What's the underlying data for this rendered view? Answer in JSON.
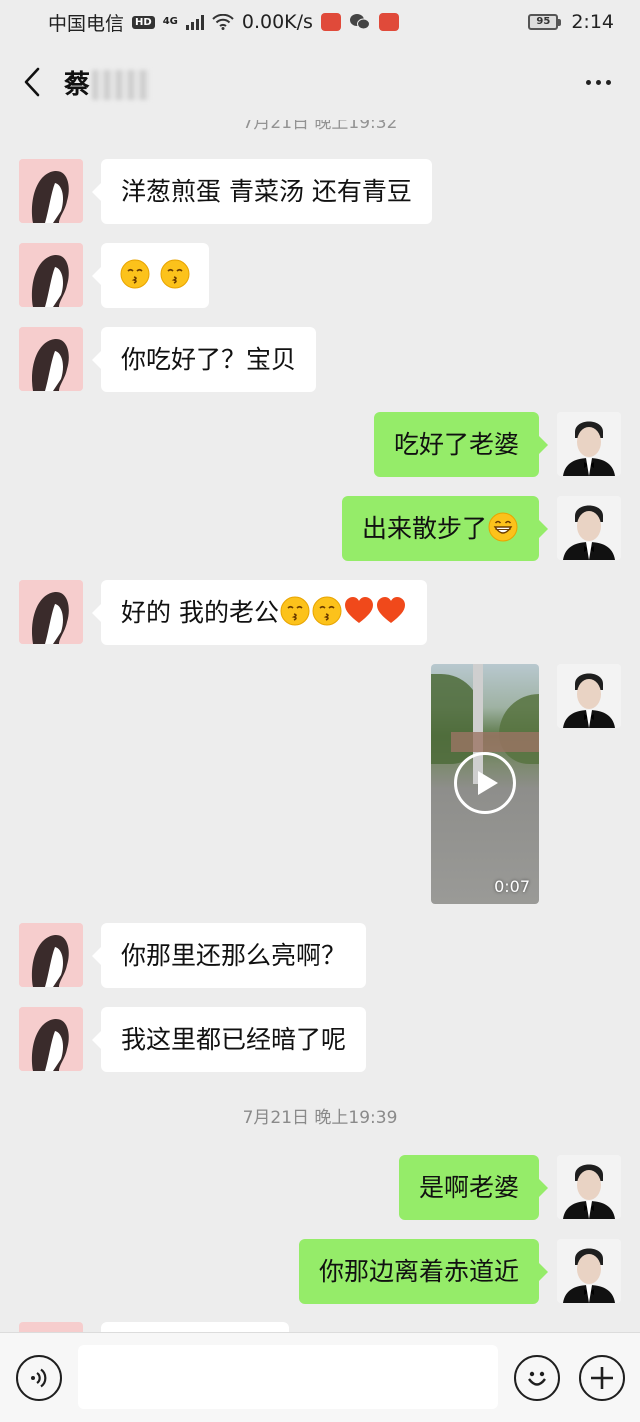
{
  "status_bar": {
    "carrier": "中国电信",
    "hd": "HD",
    "network": "4G",
    "net_speed": "0.00K/s",
    "battery": "95",
    "time": "2:14"
  },
  "header": {
    "contact_name": "蔡",
    "back_icon": "chevron-left-icon",
    "more_icon": "more-dots-icon"
  },
  "messages": [
    {
      "side": "left",
      "text": "洋葱煎蛋 青菜汤 还有青豆"
    },
    {
      "side": "left",
      "text": "",
      "emojis": [
        "kiss",
        "kiss"
      ]
    },
    {
      "side": "left",
      "text": "你吃好了？宝贝"
    },
    {
      "side": "right",
      "text": "吃好了老婆"
    },
    {
      "side": "right",
      "text": "出来散步了",
      "emojis": [
        "grin"
      ]
    },
    {
      "side": "left",
      "text": "好的 我的老公",
      "emojis": [
        "kiss",
        "kiss",
        "heart",
        "heart"
      ]
    },
    {
      "side": "right",
      "type": "video",
      "duration": "0:07"
    },
    {
      "side": "left",
      "text": "你那里还那么亮啊？"
    },
    {
      "side": "left",
      "text": "我这里都已经暗了呢"
    },
    {
      "side": "right",
      "text": "是啊老婆"
    },
    {
      "side": "right",
      "text": "你那边离着赤道近"
    }
  ],
  "timestamps": {
    "top_partial": "7月21日 晚上19:32",
    "middle": "7月21日 晚上19:39"
  },
  "input_bar": {
    "placeholder": "",
    "voice_icon": "voice-icon",
    "emoji_icon": "emoji-icon",
    "plus_icon": "plus-icon"
  },
  "colors": {
    "background": "#ededed",
    "sent_bubble": "#95ec69",
    "received_bubble": "#ffffff",
    "timestamp": "#8a8a8a"
  }
}
